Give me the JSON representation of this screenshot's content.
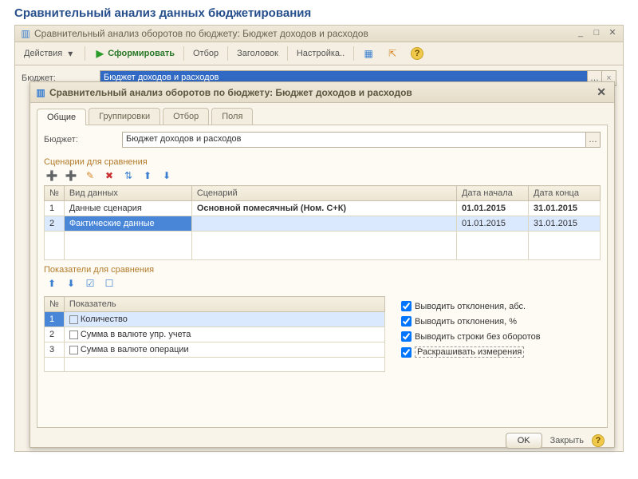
{
  "page_title": "Сравнительный анализ данных бюджетирования",
  "main_window": {
    "title": "Сравнительный анализ оборотов по бюджету: Бюджет доходов и расходов",
    "toolbar": {
      "actions": "Действия",
      "form": "Сформировать",
      "filter": "Отбор",
      "header": "Заголовок",
      "settings": "Настройка.."
    },
    "budget_label": "Бюджет:",
    "budget_value": "Бюджет доходов и расходов"
  },
  "dialog": {
    "title": "Сравнительный анализ оборотов по бюджету: Бюджет доходов и расходов",
    "tabs": [
      "Общие",
      "Группировки",
      "Отбор",
      "Поля"
    ],
    "active_tab": 0,
    "budget_label": "Бюджет:",
    "budget_value": "Бюджет доходов и расходов",
    "scenarios_section": "Сценарии для сравнения",
    "scenarios_cols": [
      "№",
      "Вид данных",
      "Сценарий",
      "Дата начала",
      "Дата конца"
    ],
    "scenarios_rows": [
      {
        "n": "1",
        "kind": "Данные сценария",
        "scenario": "Основной помесячный (Ном. С+К)",
        "start": "01.01.2015",
        "end": "31.01.2015",
        "selected": false
      },
      {
        "n": "2",
        "kind": "Фактические данные",
        "scenario": "",
        "start": "01.01.2015",
        "end": "31.01.2015",
        "selected": true
      }
    ],
    "indicators_section": "Показатели для сравнения",
    "indicators_cols": [
      "№",
      "Показатель"
    ],
    "indicators_rows": [
      {
        "n": "1",
        "label": "Количество",
        "selected": true
      },
      {
        "n": "2",
        "label": "Сумма в валюте упр. учета",
        "selected": false
      },
      {
        "n": "3",
        "label": "Сумма в валюте операции",
        "selected": false
      }
    ],
    "checks": {
      "abs": "Выводить отклонения, абс.",
      "pct": "Выводить отклонения, %",
      "noturn": "Выводить строки без оборотов",
      "colorize": "Раскрашивать измерения"
    },
    "ok": "OK",
    "close": "Закрыть"
  }
}
